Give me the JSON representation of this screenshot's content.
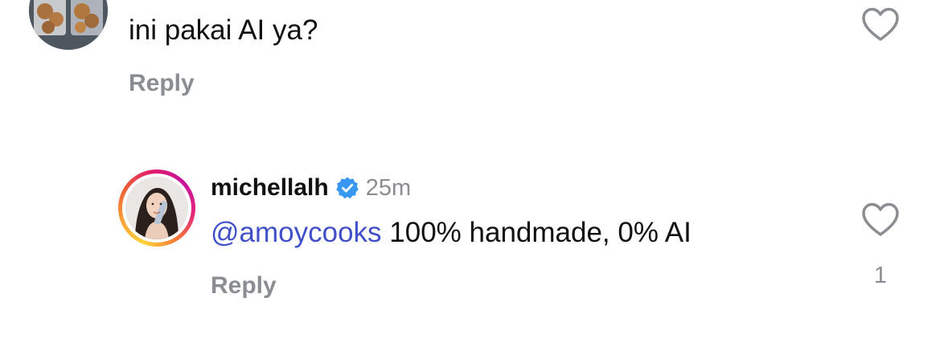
{
  "comment1": {
    "text": "ini pakai AI ya?",
    "reply_label": "Reply",
    "like_icon": "heart-outline-icon"
  },
  "comment2": {
    "username": "michellalh",
    "verified_icon": "verified-badge-icon",
    "timestamp": "25m",
    "mention": "@amoycooks",
    "text": " 100% handmade, 0% AI",
    "reply_label": "Reply",
    "like_icon": "heart-outline-icon",
    "like_count": "1"
  },
  "colors": {
    "mention": "#4150c8",
    "muted": "#8a8d91",
    "verified": "#3897f0",
    "text": "#111111"
  }
}
